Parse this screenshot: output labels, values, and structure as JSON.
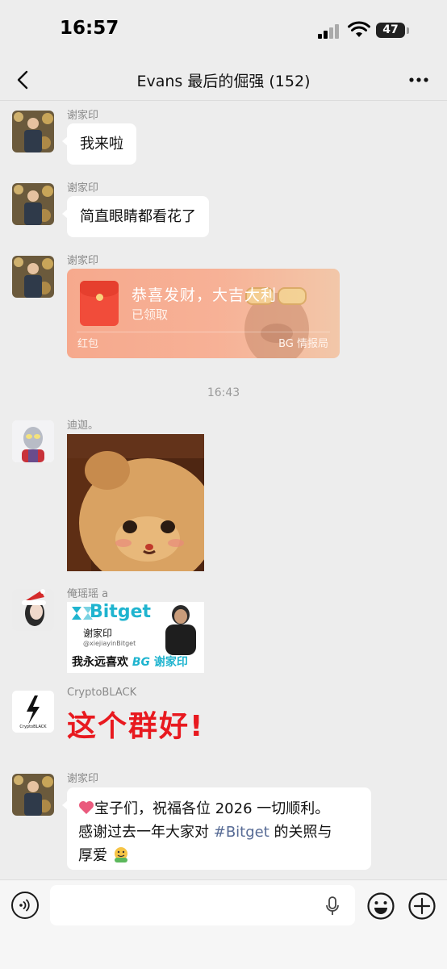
{
  "status_bar": {
    "time": "16:57",
    "battery": "47"
  },
  "nav": {
    "title": "Evans 最后的倔强 (152)"
  },
  "messages": [
    {
      "sender": "谢家印",
      "text": "我来啦"
    },
    {
      "sender": "谢家印",
      "text": "简直眼睛都看花了"
    },
    {
      "sender": "谢家印",
      "red_packet": {
        "title": "恭喜发财，大吉大利",
        "status": "已领取",
        "label": "红包",
        "source": "BG 情报局"
      }
    },
    {
      "sender": "迪迦。",
      "image": "bear-photo"
    },
    {
      "sender": "俺瑶瑶 a",
      "sticker": {
        "brand": "Bitget",
        "name": "谢家印",
        "handle": "@xiejiayinBitget",
        "caption": "我永远喜欢",
        "caption_tag": "BG",
        "caption_name": "谢家印"
      }
    },
    {
      "sender": "CryptoBLACK",
      "text": "这个群好!",
      "avatar_label": "CryptoBLACK"
    },
    {
      "sender": "谢家印",
      "text_parts": [
        "宝子们，祝福各位 2026 一切顺利。",
        "感谢过去一年大家对 ",
        "#Bitget",
        " 的关照与",
        "厚爱"
      ]
    }
  ],
  "timestamp": "16:43",
  "colors": {
    "bubble": "#ffffff",
    "background": "#ededed",
    "hashtag": "#576b95",
    "big_text": "#e8191f",
    "bitget_teal": "#1fb4cf"
  }
}
